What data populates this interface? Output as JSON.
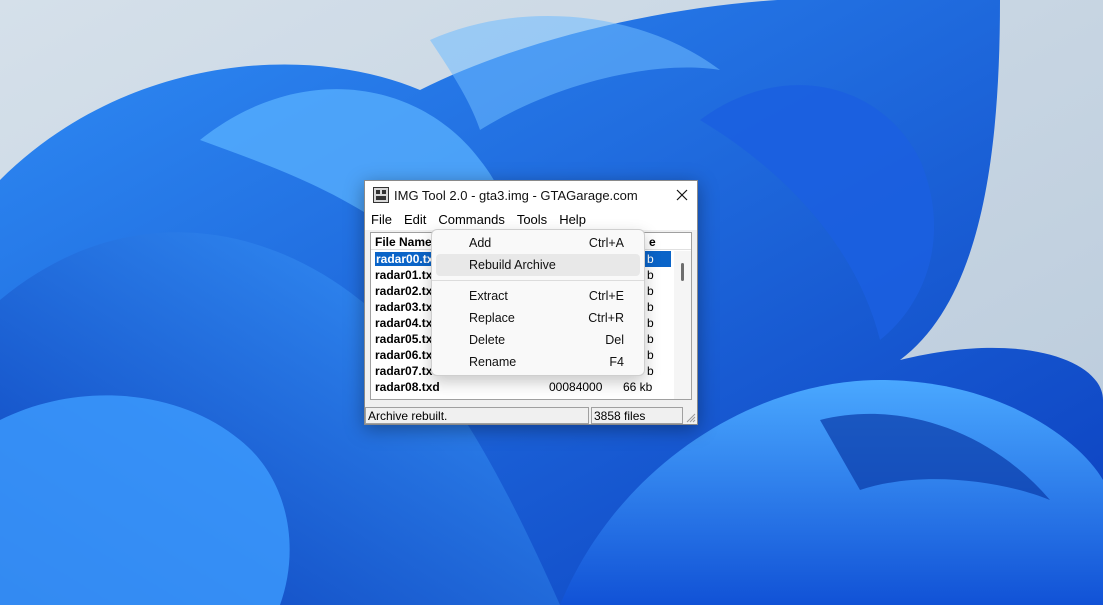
{
  "window": {
    "title": "IMG Tool 2.0 - gta3.img - GTAGarage.com"
  },
  "menubar": {
    "items": [
      "File",
      "Edit",
      "Commands",
      "Tools",
      "Help"
    ]
  },
  "list": {
    "header_name": "File Name",
    "header_size_tail": "e",
    "rows": [
      {
        "name": "radar00.tx",
        "offset": "",
        "size": "b"
      },
      {
        "name": "radar01.tx",
        "offset": "",
        "size": "b"
      },
      {
        "name": "radar02.tx",
        "offset": "",
        "size": "b"
      },
      {
        "name": "radar03.tx",
        "offset": "",
        "size": "b"
      },
      {
        "name": "radar04.tx",
        "offset": "",
        "size": "b"
      },
      {
        "name": "radar05.tx",
        "offset": "",
        "size": "b"
      },
      {
        "name": "radar06.tx",
        "offset": "",
        "size": "b"
      },
      {
        "name": "radar07.tx",
        "offset": "",
        "size": "b"
      },
      {
        "name": "radar08.txd",
        "offset": "00084000",
        "size": "66 kb"
      }
    ]
  },
  "statusbar": {
    "message": "Archive rebuilt.",
    "count": "3858 files"
  },
  "commands_menu": {
    "items": [
      {
        "label": "Add",
        "shortcut": "Ctrl+A"
      },
      {
        "label": "Rebuild Archive",
        "shortcut": ""
      },
      {
        "label": "Extract",
        "shortcut": "Ctrl+E"
      },
      {
        "label": "Replace",
        "shortcut": "Ctrl+R"
      },
      {
        "label": "Delete",
        "shortcut": "Del"
      },
      {
        "label": "Rename",
        "shortcut": "F4"
      }
    ]
  },
  "colors": {
    "selection": "#0a64c8",
    "wallpaper_blue": "#1663e0"
  }
}
